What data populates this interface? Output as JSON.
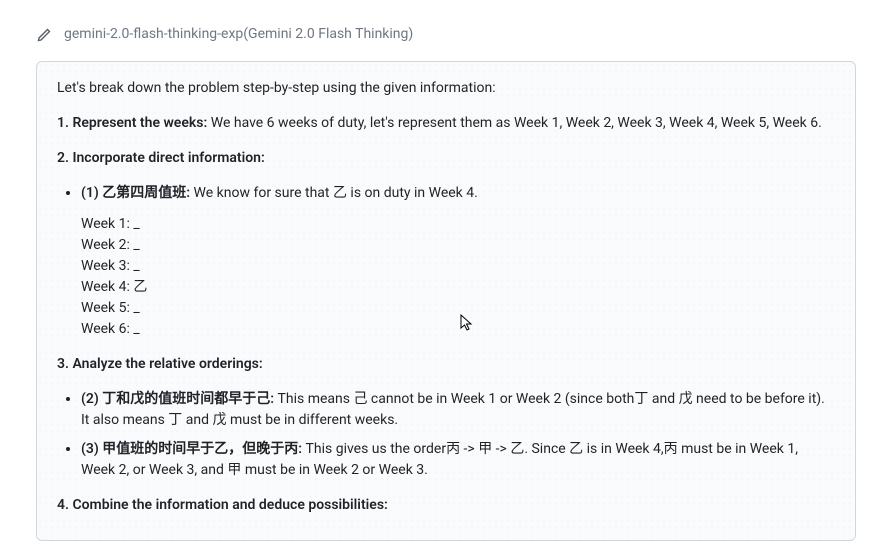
{
  "header": {
    "model_name": "gemini-2.0-flash-thinking-exp(Gemini 2.0 Flash Thinking)"
  },
  "content": {
    "intro": "Let's break down the problem step-by-step using the given information:",
    "s1": {
      "head": "1. Represent the weeks:",
      "body": " We have 6 weeks of duty, let's represent them as Week 1, Week 2, Week 3, Week 4, Week 5, Week 6."
    },
    "s2": {
      "head": "2. Incorporate direct information:",
      "item1_label": "(1) 乙第四周值班:",
      "item1_body": " We know for sure that 乙 is on duty in Week 4.",
      "weeks": {
        "w1": "Week 1: _",
        "w2": "Week 2: _",
        "w3": "Week 3: _",
        "w4": "Week 4: 乙",
        "w5": "Week 5: _",
        "w6": "Week 6: _"
      }
    },
    "s3": {
      "head": "3. Analyze the relative orderings:",
      "item2_label": "(2) 丁和戊的值班时间都早于己:",
      "item2_body": " This means 己 cannot be in Week 1 or Week 2 (since both丁 and 戊 need to be before it). It also means 丁 and 戊 must be in different weeks.",
      "item3_label": "(3) 甲值班的时间早于乙，但晚于丙:",
      "item3_body": " This gives us the order丙 -> 甲 -> 乙. Since 乙 is in Week 4,丙 must be in Week 1, Week 2, or Week 3, and 甲 must be in Week 2 or Week 3."
    },
    "s4": {
      "head_partial": "4. Combine the information and deduce possibilities:"
    }
  }
}
